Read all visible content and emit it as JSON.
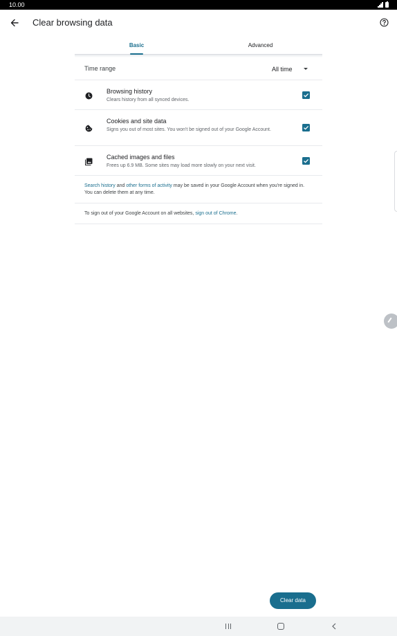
{
  "status_bar": {
    "time": "10.00"
  },
  "app_bar": {
    "title": "Clear browsing data"
  },
  "tabs": [
    {
      "label": "Basic",
      "selected": true
    },
    {
      "label": "Advanced",
      "selected": false
    }
  ],
  "time_range": {
    "label": "Time range",
    "value": "All time"
  },
  "options": [
    {
      "icon": "clock-icon",
      "title": "Browsing history",
      "description": "Clears history from all synced devices.",
      "checked": true
    },
    {
      "icon": "cookie-icon",
      "title": "Cookies and site data",
      "description": "Signs you out of most sites. You won't be signed out of your Google Account.",
      "checked": true
    },
    {
      "icon": "image-icon",
      "title": "Cached images and files",
      "description": "Frees up 6.9 MB. Some sites may load more slowly on your next visit.",
      "checked": true
    }
  ],
  "info": {
    "history_link": "Search history",
    "history_and": " and ",
    "activity_link": "other forms of activity",
    "history_rest": " may be saved in your Google Account when you're signed in. You can delete them at any time.",
    "signout_prefix": "To sign out of your Google Account on all websites, ",
    "signout_link": "sign out of Chrome",
    "signout_suffix": "."
  },
  "clear_button": {
    "label": "Clear data"
  },
  "colors": {
    "accent": "#1a6e8e",
    "divider": "#e8eaed",
    "nav_bar": "#f1f3f4"
  }
}
